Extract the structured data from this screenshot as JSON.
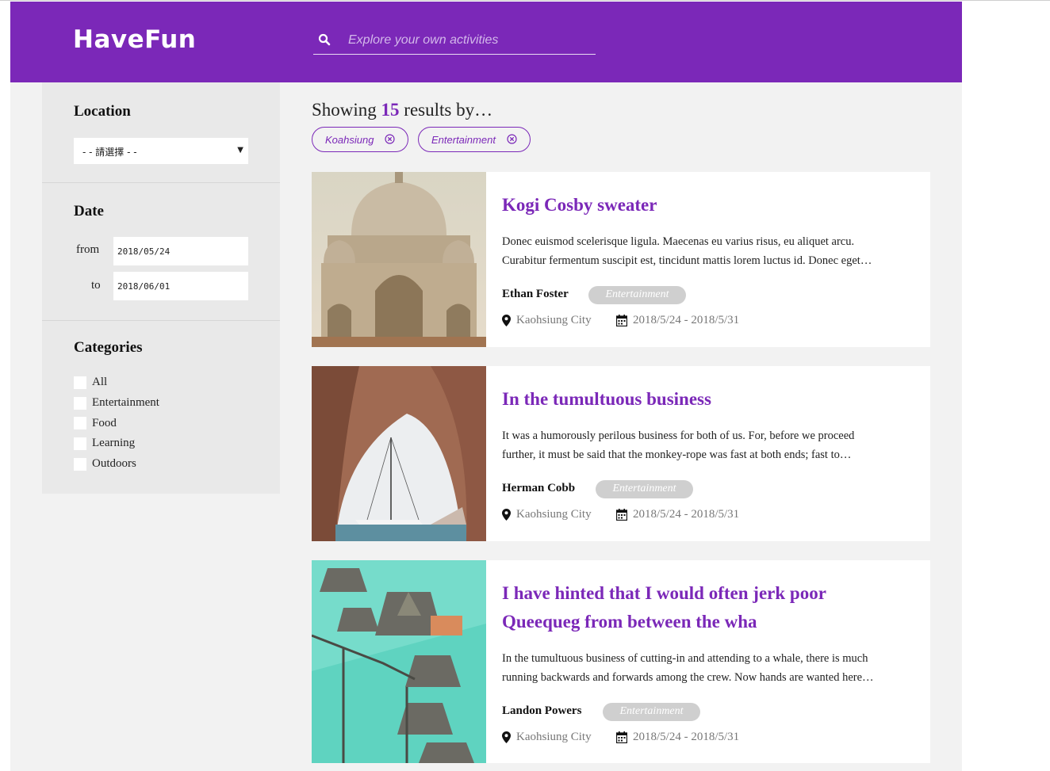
{
  "header": {
    "logo": "HaveFun",
    "search_placeholder": "Explore your own activities"
  },
  "sidebar": {
    "location": {
      "title": "Location",
      "selected": "- - 請選擇 - -"
    },
    "date": {
      "title": "Date",
      "from_label": "from",
      "from_value": "2018/05/24",
      "to_label": "to",
      "to_value": "2018/06/01"
    },
    "categories": {
      "title": "Categories",
      "items": [
        "All",
        "Entertainment",
        "Food",
        "Learning",
        "Outdoors"
      ]
    }
  },
  "results": {
    "prefix": "Showing",
    "count": "15",
    "suffix": "results by…",
    "filters": [
      "Koahsiung",
      "Entertainment"
    ]
  },
  "cards": [
    {
      "title": "Kogi Cosby sweater",
      "desc_line1": "Donec euismod scelerisque ligula. Maecenas eu varius risus, eu aliquet arcu.",
      "desc_line2": "Curabitur fermentum suscipit est, tincidunt mattis lorem luctus id. Donec eget…",
      "author": "Ethan Foster",
      "category": "Entertainment",
      "location": "Kaohsiung City",
      "dates": "2018/5/24 - 2018/5/31",
      "image": "taj-mahal-photo"
    },
    {
      "title": "In the tumultuous business",
      "desc_line1": "It was a humorously perilous business for both of us. For, before we proceed",
      "desc_line2": "further, it must be said that the monkey-rope was fast at both ends; fast to…",
      "author": "Herman Cobb",
      "category": "Entertainment",
      "location": "Kaohsiung City",
      "dates": "2018/5/24 - 2018/5/31",
      "image": "sea-arch-sailboat-photo"
    },
    {
      "title_line1": "I have hinted that I would often jerk poor",
      "title_line2": "Queequeg from between the wha",
      "desc_line1": "In the tumultuous business of cutting-in and attending to a whale, there is much",
      "desc_line2": "running backwards and forwards among the crew. Now hands are wanted here…",
      "author": "Landon Powers",
      "category": "Entertainment",
      "location": "Kaohsiung City",
      "dates": "2018/5/24 - 2018/5/31",
      "image": "overwater-bungalows-photo"
    }
  ],
  "colors": {
    "brand": "#7b28b8",
    "page_bg": "#f2f2f2",
    "sidebar_bg": "#e9e9e9",
    "badge_bg": "#cfcfcf"
  }
}
